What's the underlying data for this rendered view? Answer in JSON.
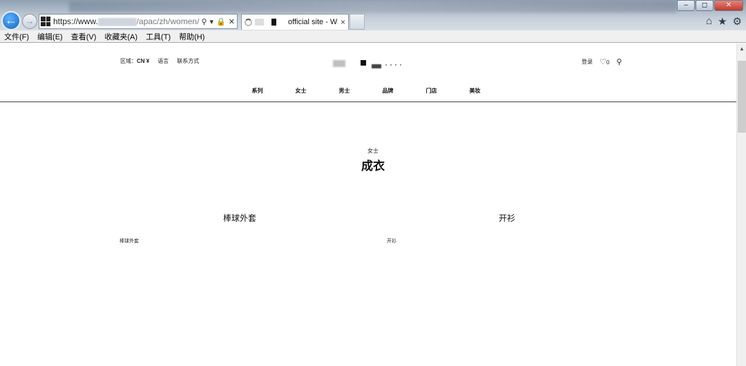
{
  "browser": {
    "address": {
      "host_prefix": "https://www.",
      "path_visible": "/apac/zh/women/rea"
    },
    "tab": {
      "title": "official site - W...",
      "close_glyph": "×"
    },
    "window_buttons": [
      "–",
      "◻",
      "✕"
    ],
    "menu": [
      "文件(F)",
      "编辑(E)",
      "查看(V)",
      "收藏夹(A)",
      "工具(T)",
      "帮助(H)"
    ]
  },
  "site": {
    "util_left": {
      "region_label": "区域：",
      "region_value": "CN ¥",
      "language": "语言",
      "contact": "联系方式"
    },
    "util_right": {
      "login": "登录",
      "wishlist_count": "0"
    },
    "nav": [
      "系列",
      "女士",
      "男士",
      "品牌",
      "门店",
      "美妆"
    ]
  },
  "main": {
    "breadcrumb": "女士",
    "title": "成衣",
    "categories": [
      {
        "heading": "棒球外套",
        "sub_label": "棒球外套"
      },
      {
        "heading": "开衫",
        "sub_label": "开衫"
      }
    ]
  }
}
